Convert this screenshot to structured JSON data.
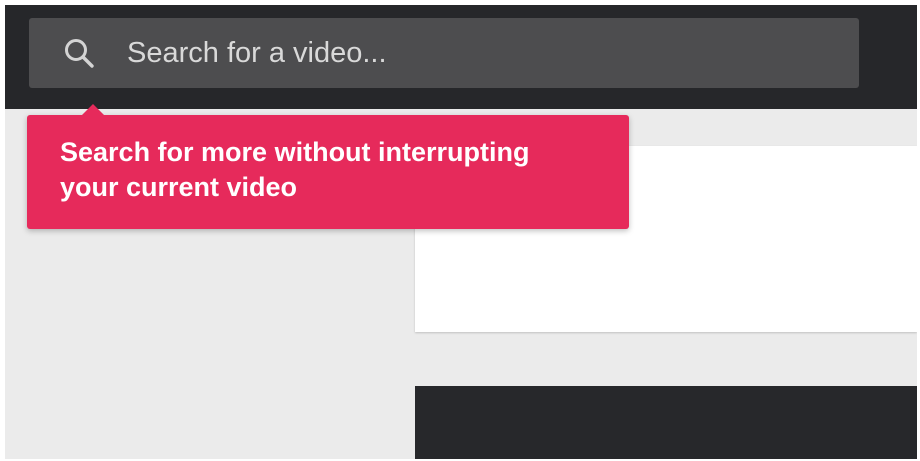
{
  "search": {
    "placeholder": "Search for a video...",
    "icon": "search-icon"
  },
  "tooltip": {
    "line1": "Search for more without interrupting",
    "line2": "your current video"
  },
  "colors": {
    "topbar": "#26272a",
    "search_box": "#4d4d4f",
    "tooltip_accent": "#e62a5b",
    "page_background": "#ebebeb",
    "card_white": "#ffffff",
    "card_dark": "#27282b"
  }
}
